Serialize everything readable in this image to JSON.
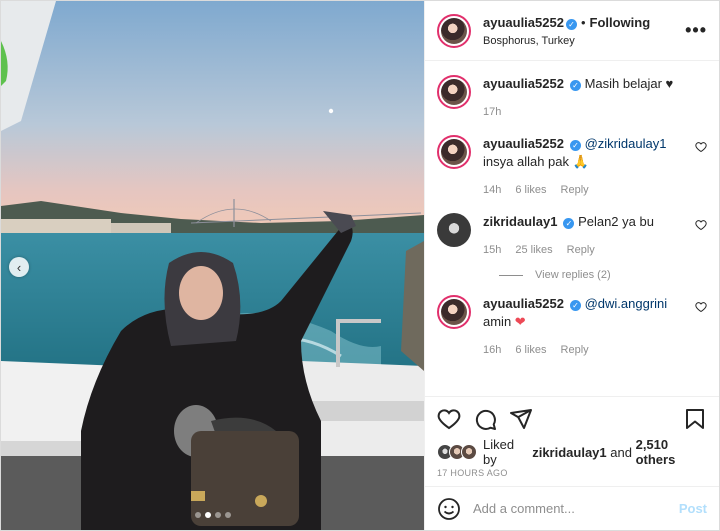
{
  "post": {
    "username": "ayuaulia5252",
    "follow_status": "Following",
    "location": "Bosphorus, Turkey",
    "more_label": "•••",
    "carousel": {
      "dots": 4,
      "active_index": 1,
      "prev_arrow": "‹"
    }
  },
  "comments": [
    {
      "username": "ayuaulia5252",
      "text": "Masih belajar ♥",
      "mention": "",
      "time": "17h",
      "likes": "",
      "reply": "",
      "heart": false,
      "avatar": "ring"
    },
    {
      "username": "ayuaulia5252",
      "mention": "@zikridaulay1",
      "text": "insya allah pak 🙏",
      "time": "14h",
      "likes": "6 likes",
      "reply": "Reply",
      "heart": true,
      "avatar": "ring"
    },
    {
      "username": "zikridaulay1",
      "mention": "",
      "text": "Pelan2 ya bu",
      "time": "15h",
      "likes": "25 likes",
      "reply": "Reply",
      "heart": true,
      "avatar": "plain",
      "view_replies": "View replies (2)"
    },
    {
      "username": "ayuaulia5252",
      "mention": "@dwi.anggrini",
      "text": "amin ❤",
      "time": "16h",
      "likes": "6 likes",
      "reply": "Reply",
      "heart": true,
      "avatar": "ring"
    }
  ],
  "likes": {
    "prefix": "Liked by",
    "user": "zikridaulay1",
    "and": "and",
    "count": "2,510 others"
  },
  "time_ago": "17 HOURS AGO",
  "add_comment": {
    "placeholder": "Add a comment...",
    "post_label": "Post"
  },
  "colors": {
    "verified": "#3897f0",
    "mention": "#00376b",
    "post_disabled": "#b2dffc",
    "story_ring": "#e1306c",
    "heart_red": "#ed4956"
  }
}
